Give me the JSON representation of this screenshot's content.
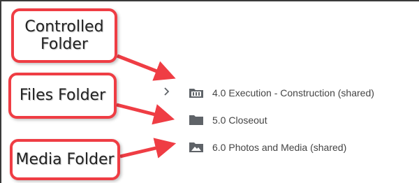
{
  "callouts": {
    "controlled": {
      "line1": "Controlled",
      "line2": "Folder"
    },
    "files": {
      "label": "Files Folder"
    },
    "media": {
      "label": "Media Folder"
    }
  },
  "folders": [
    {
      "label": "4.0 Execution - Construction (shared)",
      "icon": "controlled-folder-icon",
      "expandable": true
    },
    {
      "label": "5.0 Closeout",
      "icon": "folder-icon",
      "expandable": false
    },
    {
      "label": "6.0 Photos and Media (shared)",
      "icon": "photo-folder-icon",
      "expandable": false
    }
  ],
  "colors": {
    "callout_border": "#ef3d44",
    "arrow": "#ef3d44",
    "icon": "#5f6368",
    "text": "#444444"
  }
}
